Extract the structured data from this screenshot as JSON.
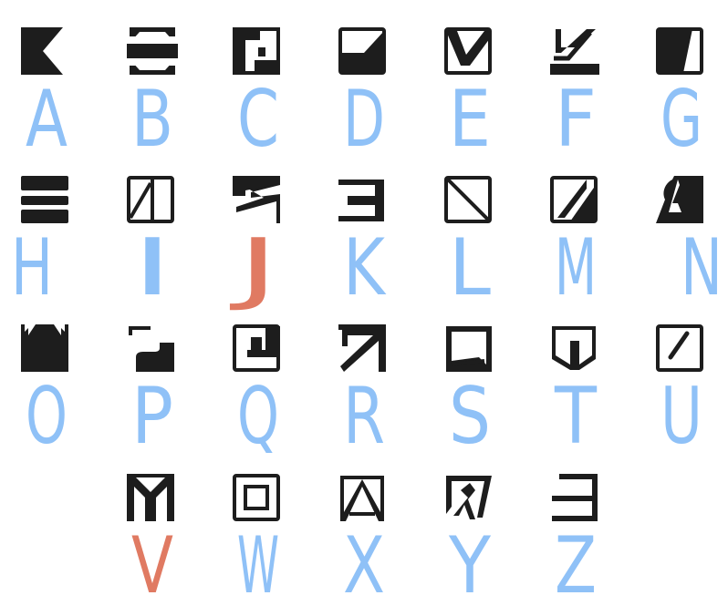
{
  "colors": {
    "ink": "#1d1d1d",
    "letter": "#8fc1f7",
    "highlight": "#e07a62"
  },
  "rows": [
    [
      {
        "letter": "A",
        "glyph": "a",
        "highlight": false
      },
      {
        "letter": "B",
        "glyph": "b",
        "highlight": false
      },
      {
        "letter": "C",
        "glyph": "c",
        "highlight": false
      },
      {
        "letter": "D",
        "glyph": "d",
        "highlight": false
      },
      {
        "letter": "E",
        "glyph": "e",
        "highlight": false
      },
      {
        "letter": "F",
        "glyph": "f",
        "highlight": false
      },
      {
        "letter": "G",
        "glyph": "g",
        "highlight": false
      }
    ],
    [
      {
        "letter": "H",
        "glyph": "h",
        "highlight": false
      },
      {
        "letter": "I",
        "glyph": "i",
        "highlight": false
      },
      {
        "letter": "J",
        "glyph": "j",
        "highlight": true
      },
      {
        "letter": "K",
        "glyph": "k",
        "highlight": false
      },
      {
        "letter": "L",
        "glyph": "l",
        "highlight": false
      },
      {
        "letter": "M",
        "glyph": "m",
        "highlight": false
      },
      {
        "letter": "N",
        "glyph": "n",
        "highlight": false
      }
    ],
    [
      {
        "letter": "O",
        "glyph": "o",
        "highlight": false
      },
      {
        "letter": "P",
        "glyph": "p",
        "highlight": false
      },
      {
        "letter": "Q",
        "glyph": "q",
        "highlight": false
      },
      {
        "letter": "R",
        "glyph": "r",
        "highlight": false
      },
      {
        "letter": "S",
        "glyph": "s",
        "highlight": false
      },
      {
        "letter": "T",
        "glyph": "t",
        "highlight": false
      },
      {
        "letter": "U",
        "glyph": "u",
        "highlight": false
      }
    ],
    [
      {
        "letter": "V",
        "glyph": "v",
        "highlight": true
      },
      {
        "letter": "W",
        "glyph": "w",
        "highlight": false
      },
      {
        "letter": "X",
        "glyph": "x",
        "highlight": false
      },
      {
        "letter": "Y",
        "glyph": "y",
        "highlight": false
      },
      {
        "letter": "Z",
        "glyph": "z",
        "highlight": false
      }
    ]
  ]
}
